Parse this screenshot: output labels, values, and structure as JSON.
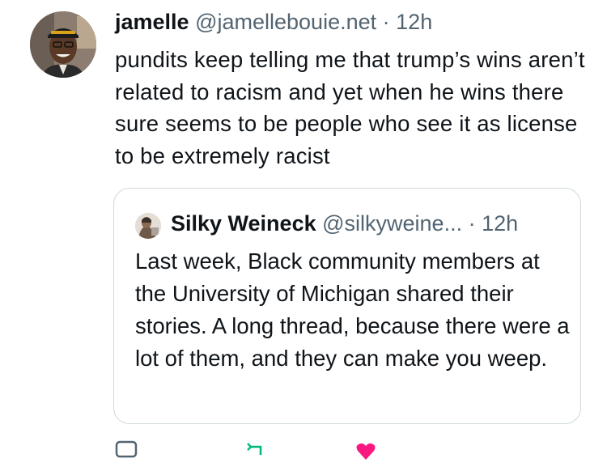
{
  "post": {
    "author_name": "jamelle",
    "handle": "@jamellebouie.net",
    "separator": "·",
    "time": "12h",
    "text": "pundits keep telling me that trump’s wins aren’t related to racism and yet when he wins there sure seems to be people who see it as license to be extremely racist"
  },
  "quoted": {
    "author_name": "Silky Weineck",
    "handle": "@silkyweine...",
    "separator": "·",
    "time": "12h",
    "text": "Last week, Black community members at the University of Michigan shared their stories. A long thread, because there were a lot of them, and they can make you weep."
  },
  "actions": {
    "icons": [
      "reply-icon",
      "retweet-icon",
      "like-icon"
    ],
    "colors": {
      "reply": "#536471",
      "retweet": "#00ba7c",
      "like": "#f91880"
    }
  }
}
